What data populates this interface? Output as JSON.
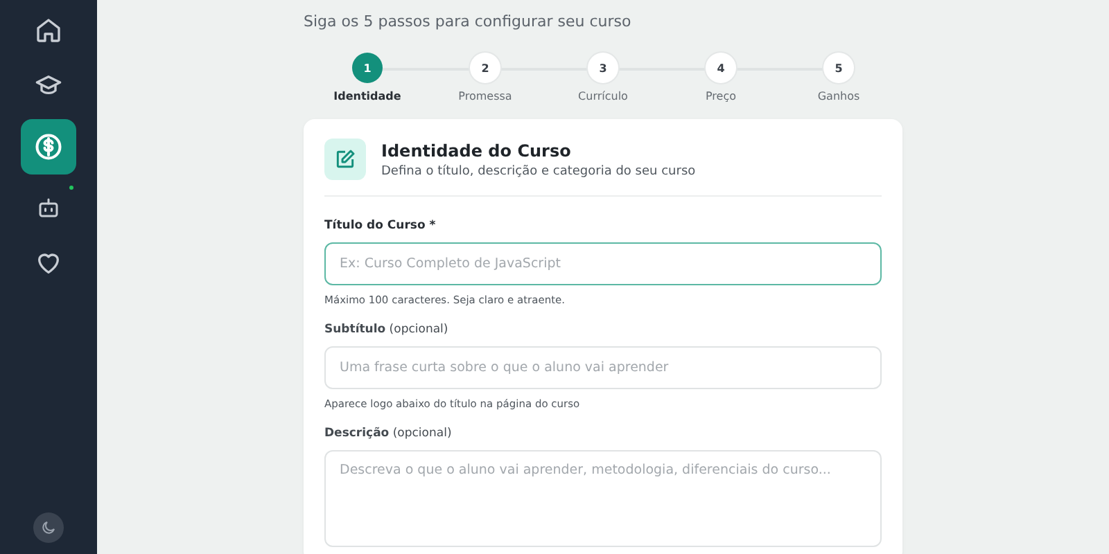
{
  "sidebar": {
    "items": [
      {
        "kind": "home",
        "selected": false,
        "dot": false
      },
      {
        "kind": "courses",
        "selected": false,
        "dot": false
      },
      {
        "kind": "money",
        "selected": true,
        "dot": false
      },
      {
        "kind": "bot",
        "selected": false,
        "dot": true
      },
      {
        "kind": "heart",
        "selected": false,
        "dot": false
      }
    ],
    "theme_toggle": {
      "kind": "moon"
    }
  },
  "intro": "Siga os 5 passos para configurar seu curso",
  "steps": [
    {
      "number": "1",
      "label": "Identidade",
      "selected": true
    },
    {
      "number": "2",
      "label": "Promessa",
      "selected": false
    },
    {
      "number": "3",
      "label": "Currículo",
      "selected": false
    },
    {
      "number": "4",
      "label": "Preço",
      "selected": false
    },
    {
      "number": "5",
      "label": "Ganhos",
      "selected": false
    }
  ],
  "card": {
    "title": "Identidade do Curso",
    "subtitle": "Defina o título, descrição e categoria do seu curso",
    "fields": [
      {
        "kind": "input",
        "required": true,
        "label": "Título do Curso *",
        "placeholder": "Ex: Curso Completo de JavaScript",
        "focused": true,
        "hint": "Máximo 100 caracteres. Seja claro e atraente."
      },
      {
        "kind": "input",
        "required": false,
        "label": "**Subtítulo** (opcional)",
        "placeholder": "Uma frase curta sobre o que o aluno vai aprender",
        "focused": false,
        "hint": "Aparece logo abaixo do título na página do curso"
      },
      {
        "kind": "textarea",
        "required": false,
        "label": "**Descrição** (opcional)",
        "placeholder": "Descreva o que o aluno vai aprender, metodologia, diferenciais do curso...",
        "focused": false
      }
    ]
  }
}
